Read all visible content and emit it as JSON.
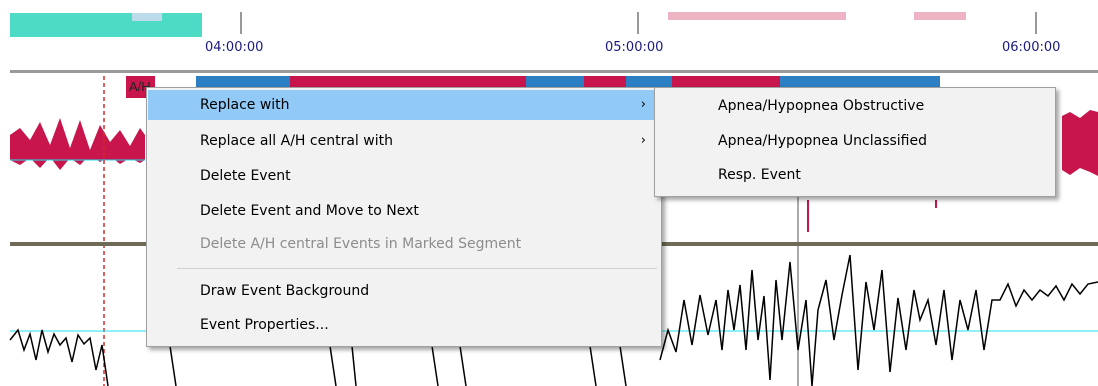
{
  "timeline": {
    "labels": [
      "04:00:00",
      "05:00:00",
      "06:00:00"
    ]
  },
  "event_tag": "A/H",
  "colors": {
    "teal": "#4edbc6",
    "pink": "#efb4c4",
    "crimson": "#c8164c",
    "blue": "#2d7fc4",
    "cyan_line": "#22e0f0",
    "divider": "#6e6a55",
    "highlight": "#91c9f7"
  },
  "context_menu": {
    "items": [
      {
        "label": "Replace with",
        "has_submenu": true,
        "highlighted": true,
        "enabled": true
      },
      {
        "label": "Replace all A/H central with",
        "has_submenu": true,
        "highlighted": false,
        "enabled": true
      },
      {
        "label": "Delete Event",
        "has_submenu": false,
        "highlighted": false,
        "enabled": true
      },
      {
        "label": "Delete Event and Move to Next",
        "has_submenu": false,
        "highlighted": false,
        "enabled": true
      },
      {
        "label": "Delete A/H central Events in Marked Segment",
        "has_submenu": false,
        "highlighted": false,
        "enabled": false
      },
      {
        "label": "Draw Event Background",
        "has_submenu": false,
        "highlighted": false,
        "enabled": true
      },
      {
        "label": "Event Properties...",
        "has_submenu": false,
        "highlighted": false,
        "enabled": true
      }
    ]
  },
  "submenu": {
    "items": [
      {
        "label": "Apnea/Hypopnea Obstructive"
      },
      {
        "label": "Apnea/Hypopnea Unclassified"
      },
      {
        "label": "Resp. Event"
      }
    ]
  }
}
